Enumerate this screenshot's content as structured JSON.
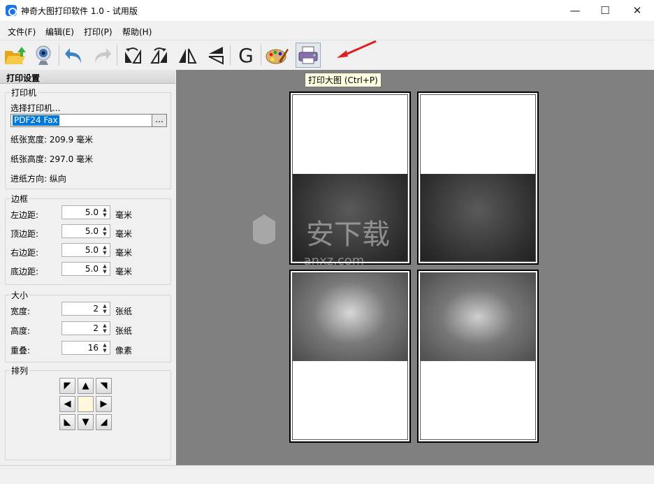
{
  "window": {
    "title": "神奇大图打印软件 1.0 - 试用版",
    "minimize": "—",
    "maximize": "☐",
    "close": "✕"
  },
  "menu": [
    "文件(F)",
    "编辑(E)",
    "打印(P)",
    "帮助(H)"
  ],
  "toolbar": {
    "tooltip": "打印大图 (Ctrl+P)",
    "g_label": "G"
  },
  "panel": {
    "header": "打印设置",
    "printer": {
      "title": "打印机",
      "select_label": "选择打印机...",
      "selected": "PDF24 Fax",
      "browse": "...",
      "paper_width": "纸张宽度: 209.9 毫米",
      "paper_height": "纸张高度: 297.0 毫米",
      "feed_direction": "进纸方向: 纵向"
    },
    "margins": {
      "title": "边框",
      "left_label": "左边距:",
      "left_value": "5.0",
      "top_label": "顶边距:",
      "top_value": "5.0",
      "right_label": "右边距:",
      "right_value": "5.0",
      "bottom_label": "底边距:",
      "bottom_value": "5.0",
      "unit": "毫米"
    },
    "size": {
      "title": "大小",
      "width_label": "宽度:",
      "width_value": "2",
      "width_unit": "张纸",
      "height_label": "高度:",
      "height_value": "2",
      "height_unit": "张纸",
      "overlap_label": "重叠:",
      "overlap_value": "16",
      "overlap_unit": "像素"
    },
    "arrange": {
      "title": "排列"
    }
  },
  "watermark": {
    "text": "安下载",
    "subtext": "anxz.com"
  },
  "colors": {
    "selection": "#0078d7",
    "preview_bg": "#808080",
    "tooltip_bg": "#ffffe1",
    "arrow_red": "#e02020"
  }
}
